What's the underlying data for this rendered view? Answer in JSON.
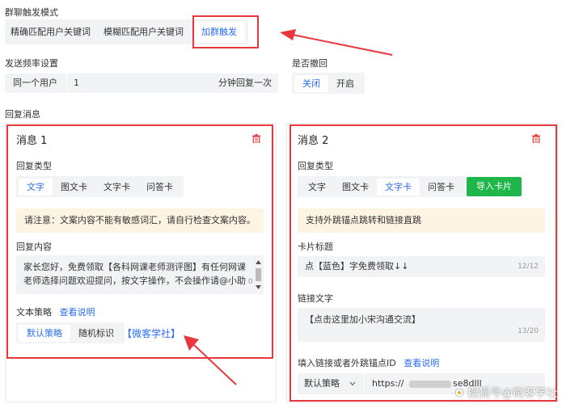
{
  "trigger_mode": {
    "label": "群聊触发模式",
    "options": [
      "精确匹配用户关键词",
      "模糊匹配用户关键词",
      "加群触发"
    ],
    "active": 2
  },
  "frequency": {
    "label": "发送频率设置",
    "scope": "同一个用户",
    "value": "1",
    "unit": "分钟回复一次"
  },
  "recall": {
    "label": "是否撤回",
    "options": [
      "关闭",
      "开启"
    ],
    "active": 0
  },
  "reply_messages_label": "回复消息",
  "message1": {
    "title": "消息 1",
    "reply_type_label": "回复类型",
    "types": [
      "文字",
      "图文卡",
      "文字卡",
      "问答卡"
    ],
    "active_type": 0,
    "notice": "请注意：文案内容不能有敏感词汇，请自行检查文案内容。",
    "content_label": "回复内容",
    "content_line1": "家长您好，免费领取【各科网课老师测评图】有任何网课",
    "content_line2": "老师选择问题欢迎提问，按文字操作，不会操作请@小助",
    "content_counter": "0",
    "strategy_label": "文本策略",
    "strategy_link": "查看说明",
    "strategies": [
      "默认策略",
      "随机标识"
    ],
    "active_strategy": 0,
    "tag": "【微客学社】"
  },
  "message2": {
    "title": "消息 2",
    "reply_type_label": "回复类型",
    "types": [
      "文字",
      "图文卡",
      "文字卡",
      "问答卡"
    ],
    "active_type": 2,
    "import_button": "导入卡片",
    "notice": "支持外跳锚点跳转和链接直跳",
    "card_title_label": "卡片标题",
    "card_title_value": "点【蓝色】字免费领取↓↓",
    "card_title_counter": "12/12",
    "link_text_label": "链接文字",
    "link_text_value": "【点击这里加小宋沟通交流】",
    "link_text_counter": "13/20",
    "link_id_label": "填入链接或者外跳锚点ID",
    "link_id_help": "查看说明",
    "strategy_select": "默认策略",
    "url_prefix": "https://",
    "url_suffix": "se8dlll"
  },
  "watermark": "搜狐号@微客学社",
  "colors": {
    "accent": "#2b6ef2",
    "annotation_red": "#e8383d",
    "notice_bg": "#fdf4e3",
    "green": "#1fb64a"
  }
}
